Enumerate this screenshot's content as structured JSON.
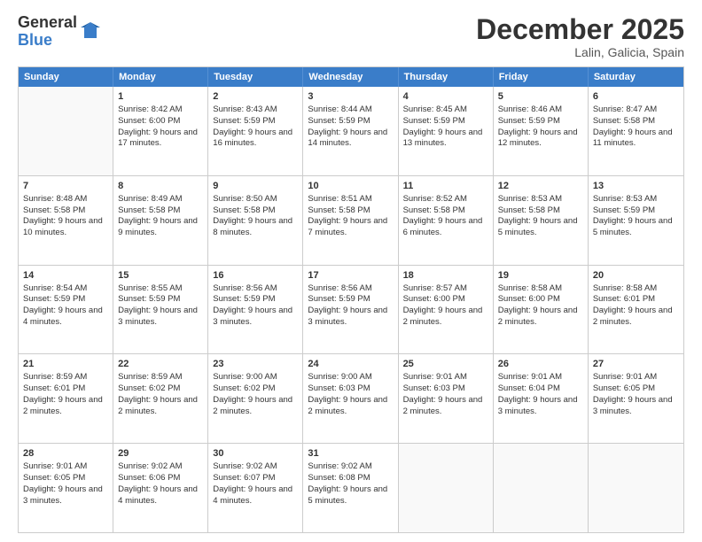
{
  "logo": {
    "general": "General",
    "blue": "Blue"
  },
  "title": "December 2025",
  "location": "Lalin, Galicia, Spain",
  "days": [
    "Sunday",
    "Monday",
    "Tuesday",
    "Wednesday",
    "Thursday",
    "Friday",
    "Saturday"
  ],
  "rows": [
    [
      {
        "day": "",
        "empty": true
      },
      {
        "day": "1",
        "sunrise": "8:42 AM",
        "sunset": "6:00 PM",
        "daylight": "9 hours and 17 minutes."
      },
      {
        "day": "2",
        "sunrise": "8:43 AM",
        "sunset": "5:59 PM",
        "daylight": "9 hours and 16 minutes."
      },
      {
        "day": "3",
        "sunrise": "8:44 AM",
        "sunset": "5:59 PM",
        "daylight": "9 hours and 14 minutes."
      },
      {
        "day": "4",
        "sunrise": "8:45 AM",
        "sunset": "5:59 PM",
        "daylight": "9 hours and 13 minutes."
      },
      {
        "day": "5",
        "sunrise": "8:46 AM",
        "sunset": "5:59 PM",
        "daylight": "9 hours and 12 minutes."
      },
      {
        "day": "6",
        "sunrise": "8:47 AM",
        "sunset": "5:58 PM",
        "daylight": "9 hours and 11 minutes."
      }
    ],
    [
      {
        "day": "7",
        "sunrise": "8:48 AM",
        "sunset": "5:58 PM",
        "daylight": "9 hours and 10 minutes."
      },
      {
        "day": "8",
        "sunrise": "8:49 AM",
        "sunset": "5:58 PM",
        "daylight": "9 hours and 9 minutes."
      },
      {
        "day": "9",
        "sunrise": "8:50 AM",
        "sunset": "5:58 PM",
        "daylight": "9 hours and 8 minutes."
      },
      {
        "day": "10",
        "sunrise": "8:51 AM",
        "sunset": "5:58 PM",
        "daylight": "9 hours and 7 minutes."
      },
      {
        "day": "11",
        "sunrise": "8:52 AM",
        "sunset": "5:58 PM",
        "daylight": "9 hours and 6 minutes."
      },
      {
        "day": "12",
        "sunrise": "8:53 AM",
        "sunset": "5:58 PM",
        "daylight": "9 hours and 5 minutes."
      },
      {
        "day": "13",
        "sunrise": "8:53 AM",
        "sunset": "5:59 PM",
        "daylight": "9 hours and 5 minutes."
      }
    ],
    [
      {
        "day": "14",
        "sunrise": "8:54 AM",
        "sunset": "5:59 PM",
        "daylight": "9 hours and 4 minutes."
      },
      {
        "day": "15",
        "sunrise": "8:55 AM",
        "sunset": "5:59 PM",
        "daylight": "9 hours and 3 minutes."
      },
      {
        "day": "16",
        "sunrise": "8:56 AM",
        "sunset": "5:59 PM",
        "daylight": "9 hours and 3 minutes."
      },
      {
        "day": "17",
        "sunrise": "8:56 AM",
        "sunset": "5:59 PM",
        "daylight": "9 hours and 3 minutes."
      },
      {
        "day": "18",
        "sunrise": "8:57 AM",
        "sunset": "6:00 PM",
        "daylight": "9 hours and 2 minutes."
      },
      {
        "day": "19",
        "sunrise": "8:58 AM",
        "sunset": "6:00 PM",
        "daylight": "9 hours and 2 minutes."
      },
      {
        "day": "20",
        "sunrise": "8:58 AM",
        "sunset": "6:01 PM",
        "daylight": "9 hours and 2 minutes."
      }
    ],
    [
      {
        "day": "21",
        "sunrise": "8:59 AM",
        "sunset": "6:01 PM",
        "daylight": "9 hours and 2 minutes."
      },
      {
        "day": "22",
        "sunrise": "8:59 AM",
        "sunset": "6:02 PM",
        "daylight": "9 hours and 2 minutes."
      },
      {
        "day": "23",
        "sunrise": "9:00 AM",
        "sunset": "6:02 PM",
        "daylight": "9 hours and 2 minutes."
      },
      {
        "day": "24",
        "sunrise": "9:00 AM",
        "sunset": "6:03 PM",
        "daylight": "9 hours and 2 minutes."
      },
      {
        "day": "25",
        "sunrise": "9:01 AM",
        "sunset": "6:03 PM",
        "daylight": "9 hours and 2 minutes."
      },
      {
        "day": "26",
        "sunrise": "9:01 AM",
        "sunset": "6:04 PM",
        "daylight": "9 hours and 3 minutes."
      },
      {
        "day": "27",
        "sunrise": "9:01 AM",
        "sunset": "6:05 PM",
        "daylight": "9 hours and 3 minutes."
      }
    ],
    [
      {
        "day": "28",
        "sunrise": "9:01 AM",
        "sunset": "6:05 PM",
        "daylight": "9 hours and 3 minutes."
      },
      {
        "day": "29",
        "sunrise": "9:02 AM",
        "sunset": "6:06 PM",
        "daylight": "9 hours and 4 minutes."
      },
      {
        "day": "30",
        "sunrise": "9:02 AM",
        "sunset": "6:07 PM",
        "daylight": "9 hours and 4 minutes."
      },
      {
        "day": "31",
        "sunrise": "9:02 AM",
        "sunset": "6:08 PM",
        "daylight": "9 hours and 5 minutes."
      },
      {
        "day": "",
        "empty": true
      },
      {
        "day": "",
        "empty": true
      },
      {
        "day": "",
        "empty": true
      }
    ]
  ],
  "labels": {
    "sunrise": "Sunrise:",
    "sunset": "Sunset:",
    "daylight": "Daylight:"
  }
}
